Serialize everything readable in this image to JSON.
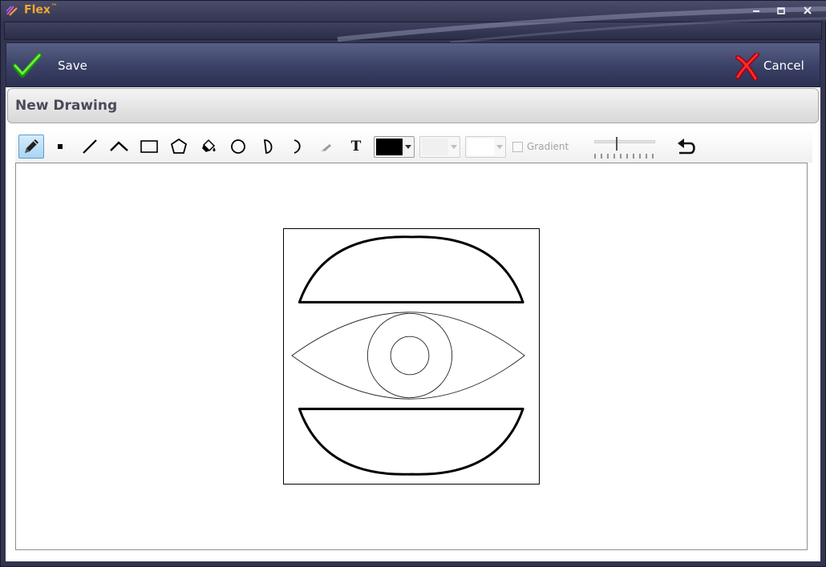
{
  "window": {
    "title": "Flex",
    "title_mark": "™",
    "controls": {
      "minimize": "-",
      "maximize": "▭",
      "close": "x"
    }
  },
  "actions": {
    "save_label": "Save",
    "cancel_label": "Cancel",
    "save_color": "#4fd11e",
    "cancel_color": "#e0101e"
  },
  "panel": {
    "title": "New Drawing"
  },
  "toolbar": {
    "tools": [
      "pencil",
      "point",
      "line",
      "polyline",
      "rectangle",
      "polygon",
      "paint-bucket",
      "ellipse",
      "closed-arc",
      "arc",
      "eraser",
      "text"
    ],
    "active_tool": "pencil",
    "text_tool_glyph": "T",
    "stroke_color": "#000000",
    "fill_color": "#ffffff",
    "gradient_label": "Gradient",
    "gradient_checked": false
  },
  "canvas": {
    "background": "#ffffff"
  }
}
